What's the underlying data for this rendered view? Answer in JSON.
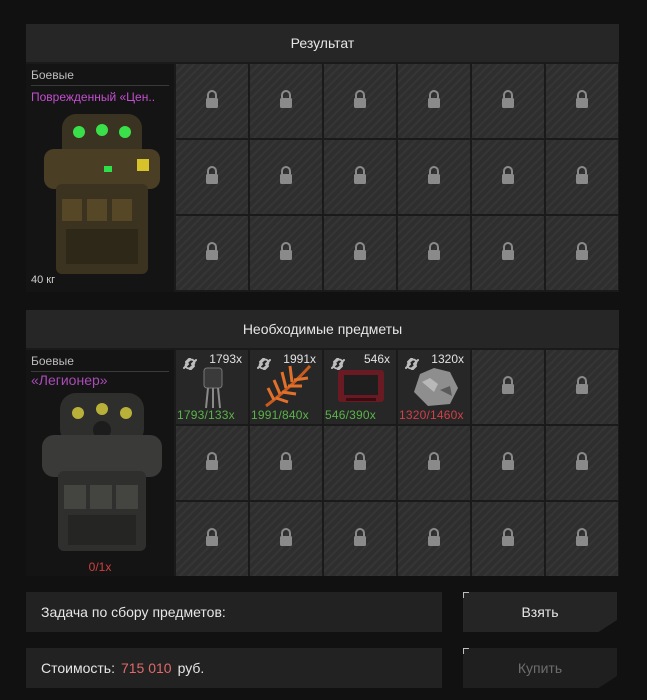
{
  "result": {
    "title": "Результат",
    "item": {
      "category": "Боевые",
      "name": "Поврежденный «Цен..",
      "weight": "40 кг"
    }
  },
  "required": {
    "title": "Необходимые предметы",
    "item": {
      "category": "Боевые",
      "name": "«Легионер»",
      "count": "0/1x"
    },
    "materials": [
      {
        "qty": "1793x",
        "ratio": "1793/133x",
        "ratio_status": "ok",
        "icon": "wire-bundle-icon"
      },
      {
        "qty": "1991x",
        "ratio": "1991/840x",
        "ratio_status": "ok",
        "icon": "fern-leaf-icon"
      },
      {
        "qty": "546x",
        "ratio": "546/390x",
        "ratio_status": "ok",
        "icon": "red-device-icon"
      },
      {
        "qty": "1320x",
        "ratio": "1320/1460x",
        "ratio_status": "bad",
        "icon": "rock-ore-icon"
      }
    ]
  },
  "task": {
    "label": "Задача по сбору предметов:"
  },
  "cost": {
    "label": "Стоимость:",
    "value": "715 010",
    "currency": "руб."
  },
  "buttons": {
    "take": "Взять",
    "buy": "Купить"
  },
  "colors": {
    "rare_name": "#c34fd0",
    "ok": "#5ab34a",
    "bad": "#d0404a",
    "price": "#e06a6a"
  }
}
